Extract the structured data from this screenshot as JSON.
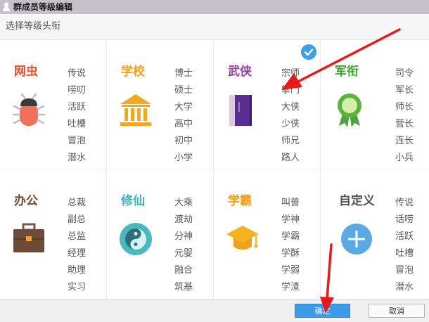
{
  "window": {
    "title": "群成员等级编辑"
  },
  "header": {
    "text": "选择等级头衔"
  },
  "cards": [
    {
      "title": "网虫",
      "color": "#e64e2f",
      "icon": "bug-icon",
      "levels": [
        "传说",
        "唠叨",
        "活跃",
        "吐槽",
        "冒泡",
        "潜水"
      ],
      "selected": false
    },
    {
      "title": "学校",
      "color": "#f0a01c",
      "icon": "school-building-icon",
      "levels": [
        "博士",
        "硕士",
        "大学",
        "高中",
        "初中",
        "小学"
      ],
      "selected": false
    },
    {
      "title": "武侠",
      "color": "#9b3fa2",
      "icon": "book-icon",
      "levels": [
        "宗师",
        "掌门",
        "大侠",
        "少侠",
        "师兄",
        "路人"
      ],
      "selected": true
    },
    {
      "title": "军衔",
      "color": "#3fa334",
      "icon": "medal-icon",
      "levels": [
        "司令",
        "军长",
        "师长",
        "营长",
        "连长",
        "小兵"
      ],
      "selected": false
    },
    {
      "title": "办公",
      "color": "#6b4a33",
      "icon": "briefcase-icon",
      "levels": [
        "总裁",
        "副总",
        "总监",
        "经理",
        "助理",
        "实习"
      ],
      "selected": false
    },
    {
      "title": "修仙",
      "color": "#3db2b8",
      "icon": "yin-yang-icon",
      "levels": [
        "大乘",
        "渡劫",
        "分神",
        "元婴",
        "融合",
        "筑基"
      ],
      "selected": false
    },
    {
      "title": "学霸",
      "color": "#f0a01c",
      "icon": "graduation-cap-icon",
      "levels": [
        "叫兽",
        "学神",
        "学霸",
        "学酥",
        "学弱",
        "学渣"
      ],
      "selected": false
    },
    {
      "title": "自定义",
      "color": "#555555",
      "icon": "plus-circle-icon",
      "levels": [
        "传说",
        "话唠",
        "活跃",
        "吐槽",
        "冒泡",
        "潜水"
      ],
      "selected": false
    }
  ],
  "footer": {
    "ok_label": "确定",
    "cancel_label": "取消"
  }
}
